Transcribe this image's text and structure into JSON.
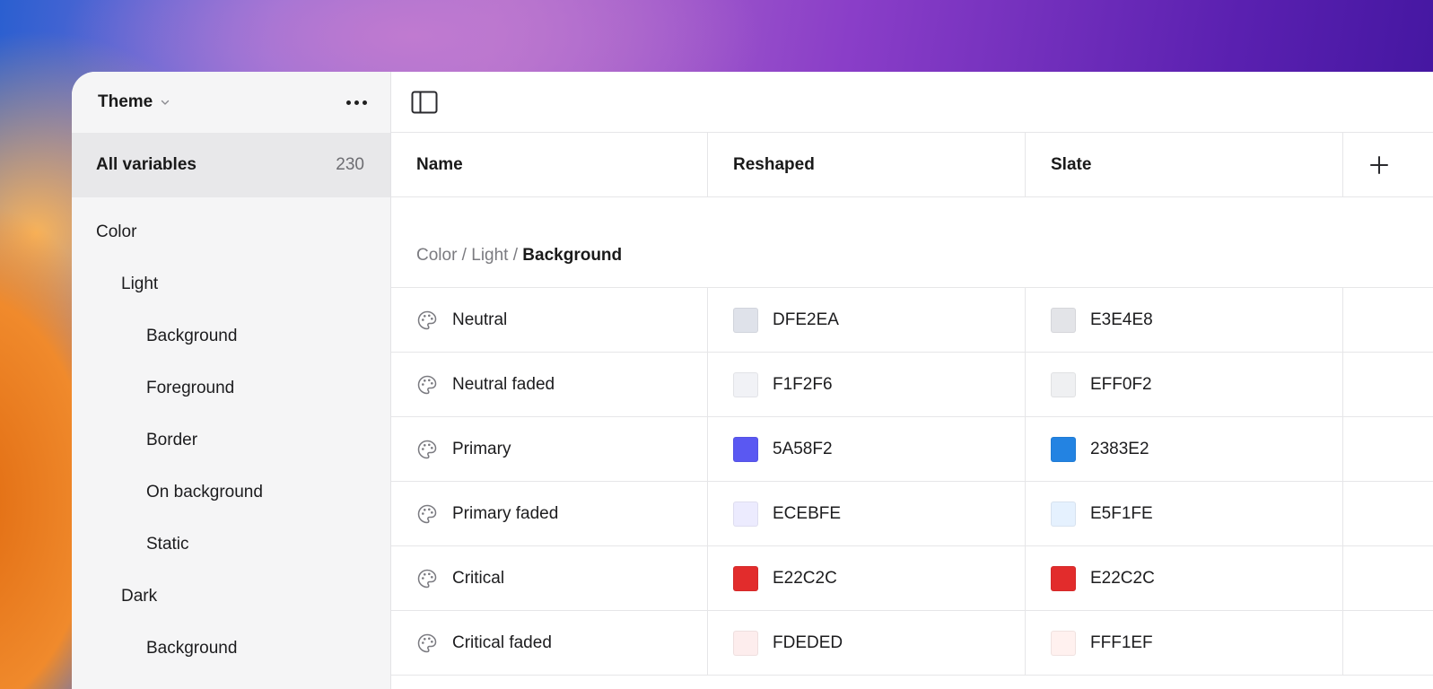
{
  "sidebar": {
    "title": "Theme",
    "all_variables_label": "All variables",
    "all_variables_count": "230",
    "tree": [
      {
        "label": "Color",
        "level": 0
      },
      {
        "label": "Light",
        "level": 1
      },
      {
        "label": "Background",
        "level": 2
      },
      {
        "label": "Foreground",
        "level": 2
      },
      {
        "label": "Border",
        "level": 2
      },
      {
        "label": "On background",
        "level": 2
      },
      {
        "label": "Static",
        "level": 2
      },
      {
        "label": "Dark",
        "level": 1
      },
      {
        "label": "Background",
        "level": 2
      }
    ]
  },
  "table": {
    "headers": {
      "name": "Name",
      "mode1": "Reshaped",
      "mode2": "Slate"
    },
    "breadcrumb": {
      "part1": "Color",
      "sep1": " / ",
      "part2": "Light",
      "sep2": " / ",
      "current": "Background"
    },
    "rows": [
      {
        "name": "Neutral",
        "reshaped": "DFE2EA",
        "slate": "E3E4E8",
        "reshaped_color": "#DFE2EA",
        "slate_color": "#E3E4E8"
      },
      {
        "name": "Neutral faded",
        "reshaped": "F1F2F6",
        "slate": "EFF0F2",
        "reshaped_color": "#F1F2F6",
        "slate_color": "#EFF0F2"
      },
      {
        "name": "Primary",
        "reshaped": "5A58F2",
        "slate": "2383E2",
        "reshaped_color": "#5A58F2",
        "slate_color": "#2383E2"
      },
      {
        "name": "Primary faded",
        "reshaped": "ECEBFE",
        "slate": "E5F1FE",
        "reshaped_color": "#ECEBFE",
        "slate_color": "#E5F1FE"
      },
      {
        "name": "Critical",
        "reshaped": "E22C2C",
        "slate": "E22C2C",
        "reshaped_color": "#E22C2C",
        "slate_color": "#E22C2C"
      },
      {
        "name": "Critical faded",
        "reshaped": "FDEDED",
        "slate": "FFF1EF",
        "reshaped_color": "#FDEDED",
        "slate_color": "#FFF1EF"
      }
    ]
  },
  "icons": {
    "row_icon": "palette-icon",
    "menu": "more-icon",
    "panel": "sidebar-toggle-icon",
    "add": "plus-icon",
    "dropdown": "chevron-down-icon"
  }
}
